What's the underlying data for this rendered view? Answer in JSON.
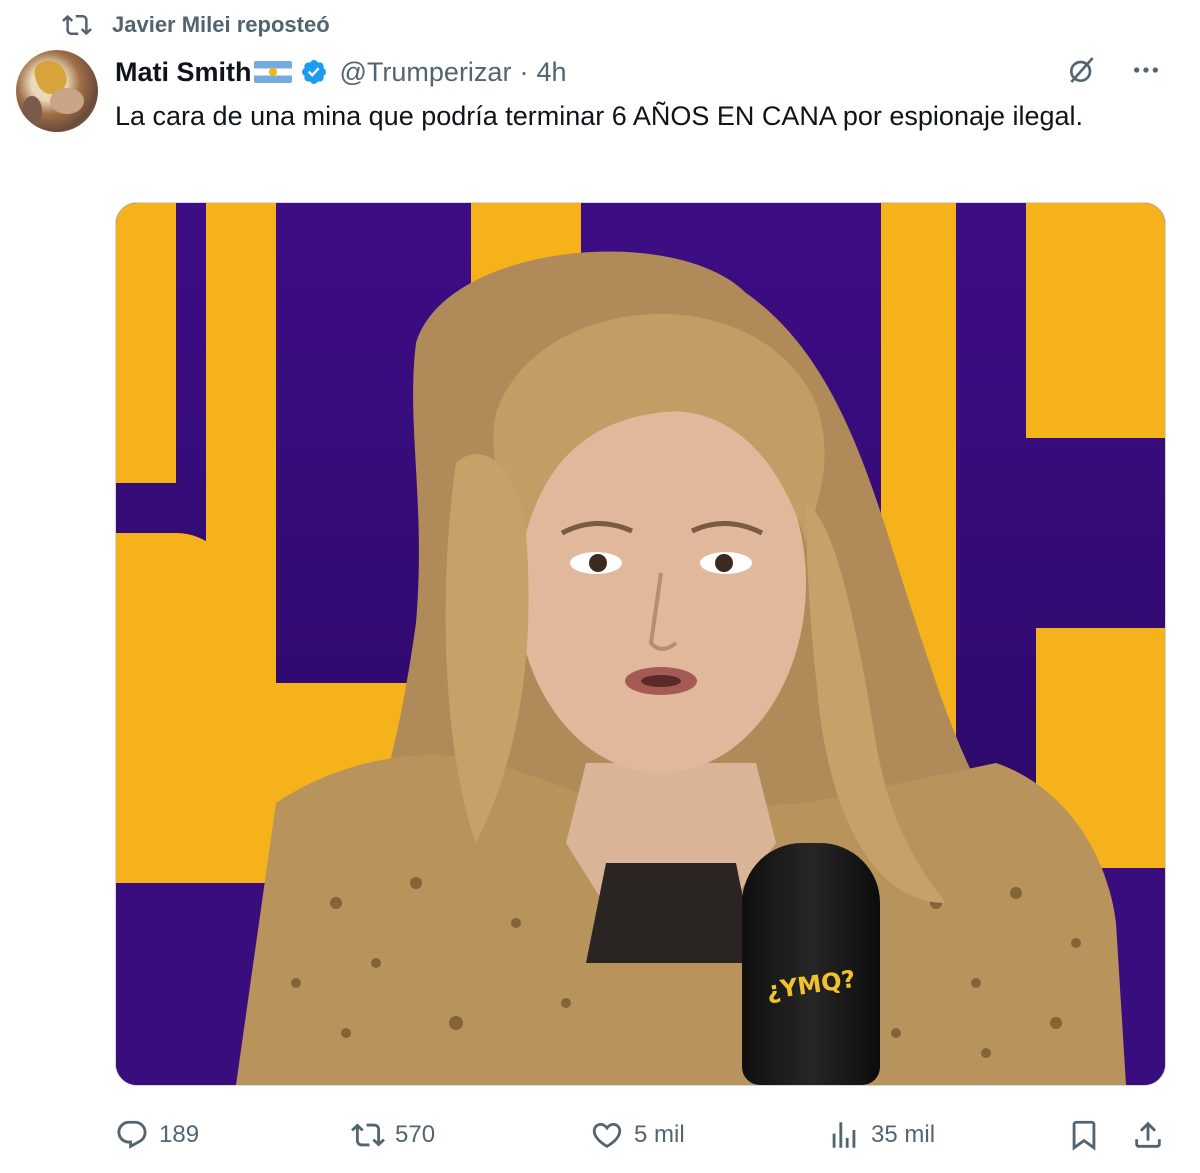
{
  "repost": {
    "label": "Javier Milei reposteó",
    "icon": "repost-icon"
  },
  "author": {
    "name": "Mati Smith",
    "flag": "argentina-flag-icon",
    "verified": true,
    "handle": "@Trumperizar",
    "time": "4h"
  },
  "tweet": {
    "text": "La cara de una mina que podría terminar 6 AÑOS EN CANA por espionaje ilegal."
  },
  "media": {
    "mic_label": "¿YMQ?"
  },
  "top_icons": [
    "grok-icon",
    "more-icon"
  ],
  "actions": {
    "replies": "189",
    "reposts": "570",
    "likes": "5 mil",
    "views": "35 mil"
  },
  "colors": {
    "text": "#0f1419",
    "muted": "#536471",
    "verified": "#1d9bf0",
    "purple": "#3d0d85",
    "yellow": "#f6b21b"
  }
}
